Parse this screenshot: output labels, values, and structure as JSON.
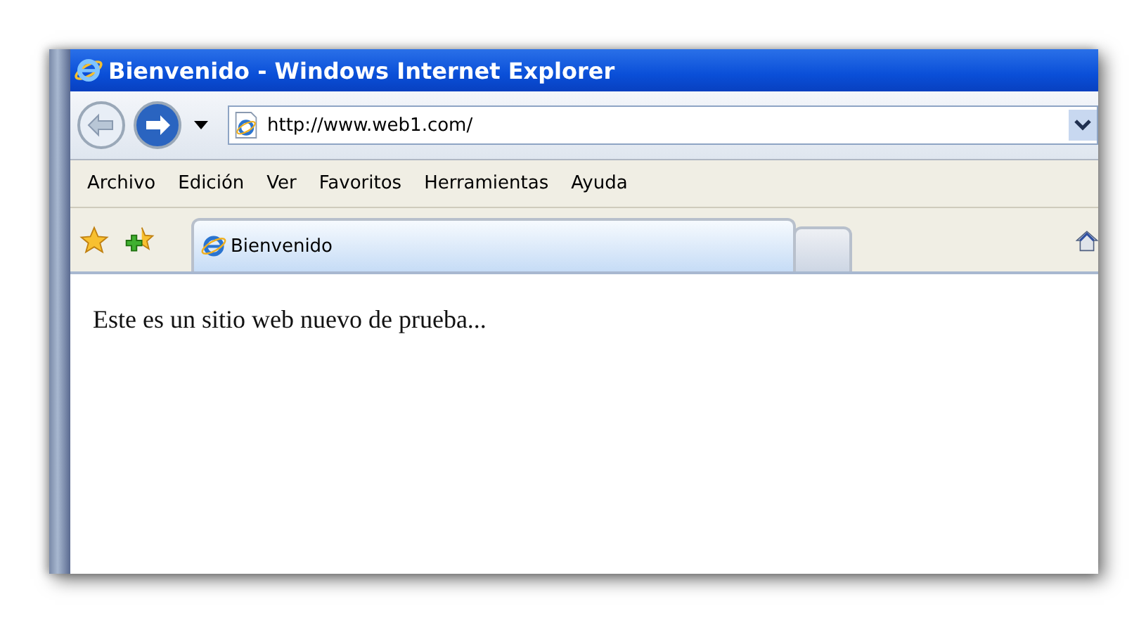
{
  "window": {
    "title": "Bienvenido - Windows Internet Explorer"
  },
  "address_bar": {
    "value": "http://www.web1.com/"
  },
  "menu": [
    "Archivo",
    "Edición",
    "Ver",
    "Favoritos",
    "Herramientas",
    "Ayuda"
  ],
  "tabs": [
    {
      "kind": "page",
      "label": "Bienvenido",
      "selected": true
    },
    {
      "kind": "new",
      "selected": false
    }
  ],
  "page": {
    "text": "Este es un sitio web nuevo de prueba..."
  }
}
